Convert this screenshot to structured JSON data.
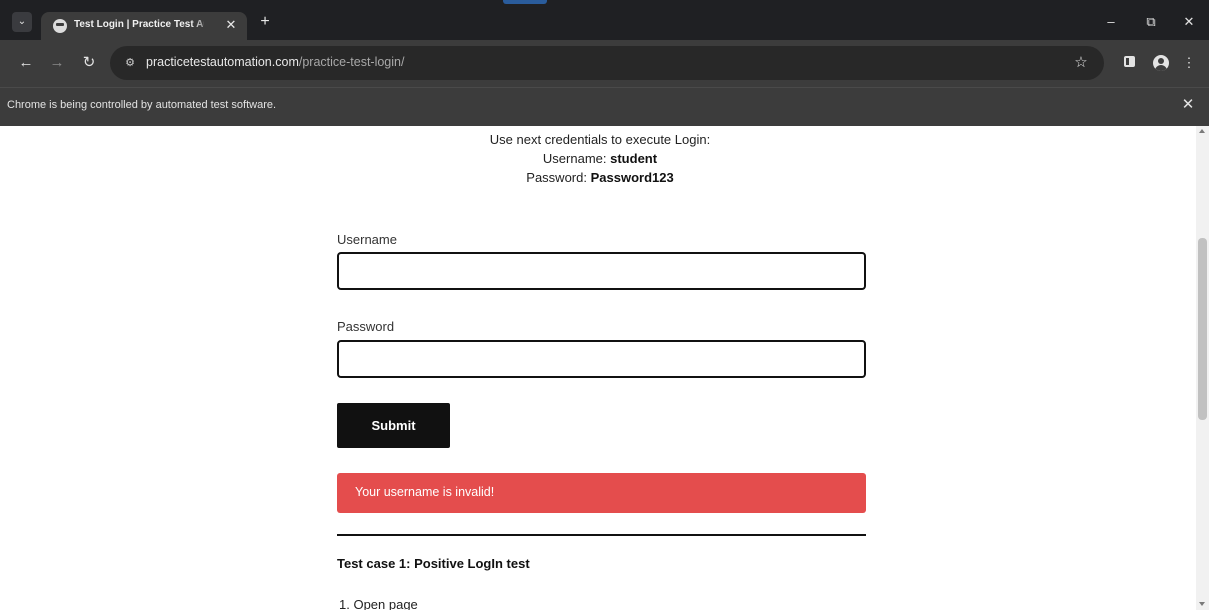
{
  "browser": {
    "tab": {
      "title": "Test Login | Practice Test Automation",
      "close_glyph": "✕"
    },
    "new_tab_glyph": "+",
    "window_controls": {
      "minimize": "–",
      "restore": "⧉",
      "close": "✕"
    },
    "toolbar": {
      "back_glyph": "←",
      "forward_glyph": "→",
      "reload_glyph": "↻",
      "site_info_glyph": "⚙",
      "url_host": "practicetestautomation.com",
      "url_path": "/practice-test-login/",
      "bookmark_glyph": "☆",
      "menu_glyph": "⋮"
    },
    "infobar": {
      "message": "Chrome is being controlled by automated test software.",
      "close_glyph": "✕"
    }
  },
  "page": {
    "credentials": {
      "intro": "Use next credentials to execute Login:",
      "username_label": "Username: ",
      "username_value": "student",
      "password_label": "Password: ",
      "password_value": "Password123"
    },
    "form": {
      "username_label": "Username",
      "username_value": "",
      "password_label": "Password",
      "password_value": "",
      "submit_label": "Submit"
    },
    "error_message": "Your username is invalid!",
    "test_case": {
      "heading": "Test case 1: Positive LogIn test",
      "steps": [
        "1. Open page"
      ]
    }
  },
  "colors": {
    "error_bg": "#e44d4d",
    "button_bg": "#111111",
    "chrome_dark": "#3c3c3c"
  },
  "icons": [
    "tab-search-icon",
    "favicon-icon",
    "close-icon",
    "new-tab-icon",
    "back-icon",
    "forward-icon",
    "reload-icon",
    "site-info-icon",
    "star-icon",
    "side-panel-icon",
    "profile-icon",
    "menu-icon"
  ]
}
